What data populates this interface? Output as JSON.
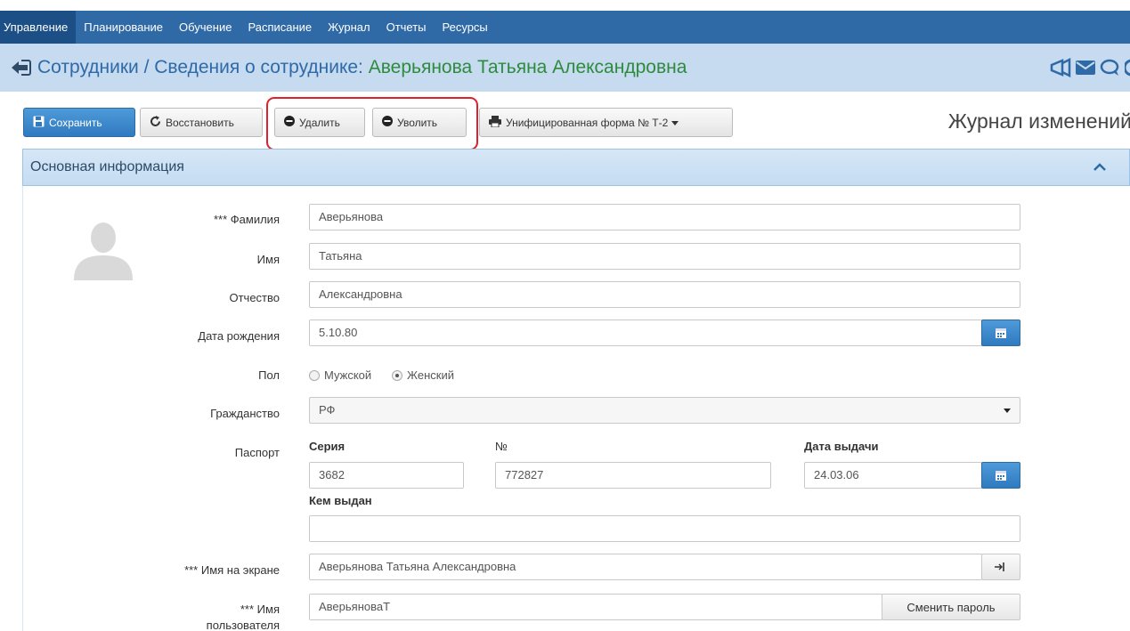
{
  "nav": {
    "items": [
      "Управление",
      "Планирование",
      "Обучение",
      "Расписание",
      "Журнал",
      "Отчеты",
      "Ресурсы"
    ],
    "active_index": 0
  },
  "breadcrumb": {
    "section": "Сотрудники",
    "separator": " / ",
    "page": "Сведения о сотруднике: ",
    "person": "Аверьянова Татьяна Александровна"
  },
  "toolbar": {
    "save": "Сохранить",
    "restore": "Восстановить",
    "delete": "Удалить",
    "dismiss": "Уволить",
    "form": "Унифицированная форма № Т-2",
    "journal": "Журнал изменений"
  },
  "panel": {
    "title": "Основная информация"
  },
  "form": {
    "surname_label": "*** Фамилия",
    "surname": "Аверьянова",
    "name_label": "Имя",
    "name": "Татьяна",
    "patronymic_label": "Отчество",
    "patronymic": "Александровна",
    "birth_label": "Дата рождения",
    "birth": "5.10.80",
    "gender_label": "Пол",
    "gender_male": "Мужской",
    "gender_female": "Женский",
    "gender_selected": "Женский",
    "citizenship_label": "Гражданство",
    "citizenship": "РФ",
    "passport_label": "Паспорт",
    "series_label": "Серия",
    "series": "3682",
    "number_label": "№",
    "number": "772827",
    "issue_date_label": "Дата выдачи",
    "issue_date": "24.03.06",
    "issued_by_label": "Кем выдан",
    "issued_by": "",
    "display_name_label": "*** Имя на экране",
    "display_name": "Аверьянова Татьяна Александровна",
    "username_label_1": "*** Имя",
    "username_label_2": "пользователя",
    "username": "АверьяноваТ",
    "change_password": "Сменить пароль"
  },
  "colors": {
    "nav_bg": "#2f6aa6",
    "crumb_bg": "#c6daf0",
    "primary": "#2f7ac0",
    "highlight": "#e0202a",
    "person_name": "#2e8b3d"
  }
}
